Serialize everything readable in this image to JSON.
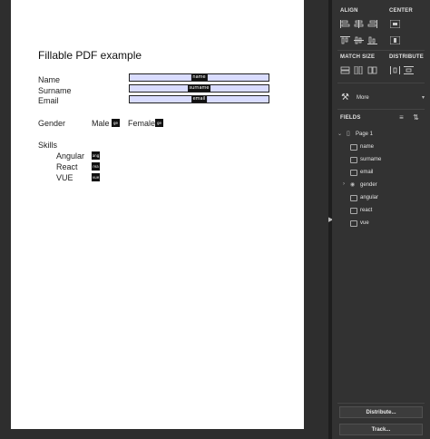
{
  "document": {
    "title": "Fillable PDF example",
    "fields": [
      {
        "label": "Name",
        "tag": "name"
      },
      {
        "label": "Surname",
        "tag": "surname"
      },
      {
        "label": "Email",
        "tag": "email"
      }
    ],
    "gender": {
      "label": "Gender",
      "male": "Male",
      "male_tag": "ge",
      "female": "Female",
      "female_tag": "ge"
    },
    "skills": {
      "label": "Skills",
      "items": [
        {
          "label": "Angular",
          "tag": "ang"
        },
        {
          "label": "React",
          "tag": "rea"
        },
        {
          "label": "VUE",
          "tag": "vue"
        }
      ]
    }
  },
  "panel": {
    "align": "ALIGN",
    "center": "CENTER",
    "match_size": "MATCH SIZE",
    "distribute": "DISTRIBUTE",
    "more": "More",
    "fields_header": "FIELDS",
    "tree": {
      "page": "Page 1",
      "items": [
        "name",
        "surname",
        "email",
        "gender",
        "angular",
        "react",
        "vue"
      ]
    },
    "distribute_button": "Distribute...",
    "track_button": "Track..."
  },
  "colors": {
    "field_fill": "#d9dcff",
    "panel_bg": "#323232",
    "canvas_bg": "#2e2e2e"
  }
}
